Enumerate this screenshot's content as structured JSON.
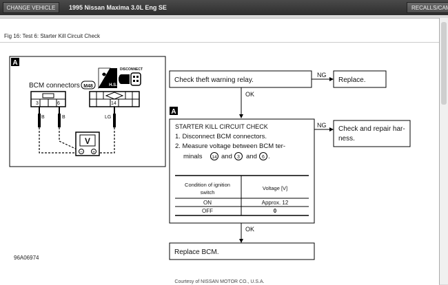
{
  "toolbar": {
    "change_vehicle": "CHANGE VEHICLE",
    "vehicle": "1995 Nissan Maxima 3.0L Eng SE",
    "recalls": "RECALLS/CAMPAIGNS"
  },
  "figure": {
    "title": "Fig 16: Test 6: Starter Kill Circuit Check",
    "code": "96A06974",
    "courtesy": "Courtesy of NISSAN MOTOR CO., U.S.A."
  },
  "wiring": {
    "label_a": "A",
    "bcm_connectors": "BCM connectors",
    "connector_id": "M48",
    "hs": "H.S.",
    "disconnect": "DISCONNECT",
    "pin_3": "3",
    "pin_6": "6",
    "pin_14": "14",
    "wire_b1": "B",
    "wire_b2": "B",
    "wire_lg": "LG",
    "meter": "V",
    "minus": "−",
    "plus": "+"
  },
  "flow": {
    "step1": "Check theft warning relay.",
    "ng1": "NG",
    "replace": "Replace.",
    "ok1": "OK",
    "label_a": "A",
    "check_title": "STARTER KILL CIRCUIT CHECK",
    "check_line1": "1. Disconnect BCM connectors.",
    "check_line2a": "2. Measure voltage between BCM ter-",
    "check_line2b": "minals",
    "check_t14": "14",
    "check_t3": "3",
    "check_and1": "and",
    "check_and2": "and",
    "check_t6": "6",
    "check_dot": ".",
    "ng2": "NG",
    "repair_line1": "Check and repair har-",
    "repair_line2": "ness.",
    "table_head_col1_l1": "Condition of ignition",
    "table_head_col1_l2": "switch",
    "table_head_col2": "Voltage [V]",
    "row1_cond": "ON",
    "row1_volt": "Approx. 12",
    "row2_cond": "OFF",
    "row2_volt": "0",
    "ok2": "OK",
    "final": "Replace BCM."
  }
}
